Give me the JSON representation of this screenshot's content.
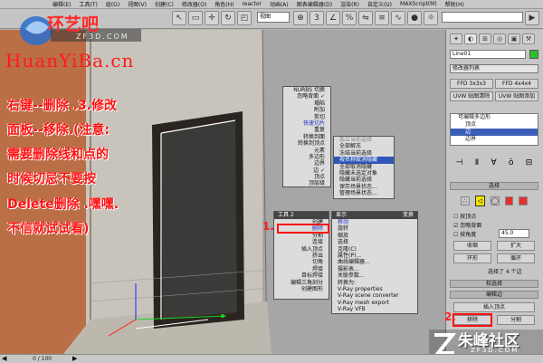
{
  "menubar": {
    "items": [
      "编辑(E)",
      "工具(T)",
      "组(G)",
      "视图(V)",
      "创建(C)",
      "修改器(O)",
      "角色(H)",
      "reactor",
      "动画(A)",
      "图表编辑器(D)",
      "渲染(R)",
      "自定义(U)",
      "MAXScript(M)",
      "帮助(H)"
    ]
  },
  "toolbar": {
    "view_select": "视图"
  },
  "watermark": {
    "brand_cn": "环艺吧",
    "brand_site": "ZF3D.COM",
    "brand_url": "HuanYiBa.cn",
    "bottom_brand": "朱峰社区",
    "bottom_site": "ZF3D.COM"
  },
  "instructions": {
    "lines": [
      "右键--删除 .3.修改",
      "面板--移除.(注意:",
      "需要删除线和点的",
      "时候切忌不要按",
      "Delete删除 .嘿嘿.",
      "不信就试试看)"
    ]
  },
  "markers": {
    "one": "1.",
    "two": "2."
  },
  "quad_upper": {
    "rows": [
      "NURBS 切换",
      "忽略背面 ✓",
      "塌陷",
      "附加",
      "剪切",
      "快速切片",
      "重复",
      "转换到面",
      "转换到顶点",
      "元素",
      "多边形",
      "边界",
      "边 ✓",
      "顶点",
      "顶层级"
    ],
    "right_rows": [
      "孤立当前选择",
      "全部解冻",
      "冻结当前选择",
      "按名称取消隐藏",
      "全部取消隐藏",
      "隐藏未选定对象",
      "隐藏当前选择",
      "保存场景状态...",
      "管理场景状态..."
    ]
  },
  "quad_lower": {
    "left_header": "工具 2",
    "right_header": "变换",
    "left_rows": [
      "创建",
      "删除",
      "分割",
      "连接",
      "插入顶点",
      "挤出",
      "切角",
      "焊接",
      "目标焊接",
      "编辑三角剖分",
      "创建图形"
    ],
    "right_rows": [
      "移动",
      "旋转",
      "缩放",
      "选择",
      "克隆(C)",
      "属性(P)...",
      "曲线编辑器...",
      "摄影表...",
      "关联参数...",
      "转换为:",
      "V-Ray properties",
      "V-Ray scene converter",
      "V-Ray mesh export",
      "V-Ray VFB"
    ],
    "top_right_label": "显示"
  },
  "command_panel": {
    "object_name": "Line01",
    "modifier_list": "修改器列表",
    "buttons_row1": [
      "FFD 3x3x3",
      "FFD 4x4x4"
    ],
    "buttons_row2": [
      "UVW 贴图清除",
      "UVW 贴图添加"
    ],
    "stack_items": [
      "可编辑多边形",
      "顶点",
      "边",
      "边界"
    ],
    "rollout_select": "选择",
    "by_vertex": "按顶点",
    "ignore_backface": "忽略背面",
    "by_angle": "按角度",
    "angle_value": "45.0",
    "shrink": "收缩",
    "grow": "扩大",
    "ring": "环形",
    "loop": "循环",
    "selection_info": "选择了 4 个边",
    "soft_selection": "软选择",
    "edit_edges": "编辑边",
    "insert_vertex": "插入顶点",
    "remove": "移除",
    "split": "分割"
  },
  "status": {
    "frame": "0 / 100"
  },
  "colors": {
    "accent_red": "#ff1010",
    "selection_blue": "#2f56b8"
  }
}
